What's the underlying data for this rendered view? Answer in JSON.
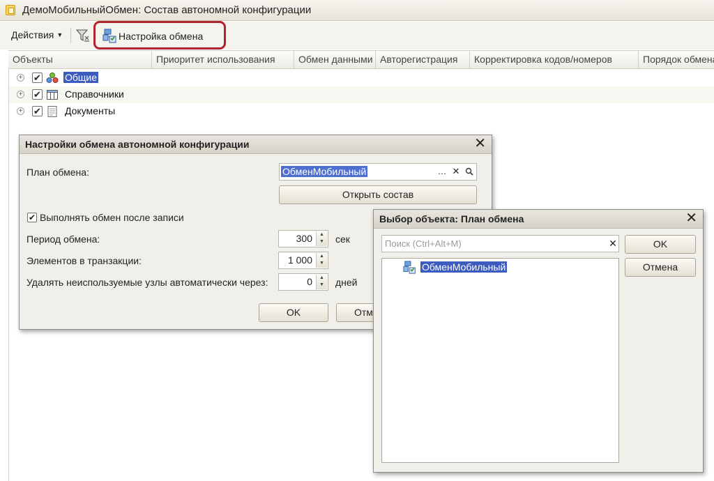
{
  "main": {
    "title": "ДемоМобильныйОбмен: Состав автономной конфигурации",
    "toolbar": {
      "actions_label": "Действия",
      "settings_label": "Настройка обмена"
    },
    "columns": [
      "Объекты",
      "Приоритет использования",
      "Обмен данными",
      "Авторегистрация",
      "Корректировка кодов/номеров",
      "Порядок обмена"
    ],
    "rows": [
      {
        "label": "Общие",
        "checked": true,
        "selected": true,
        "icon": "common-objects-icon"
      },
      {
        "label": "Справочники",
        "checked": true,
        "selected": false,
        "icon": "catalog-icon"
      },
      {
        "label": "Документы",
        "checked": true,
        "selected": false,
        "icon": "document-icon"
      }
    ]
  },
  "settings_dialog": {
    "title": "Настройки обмена автономной конфигурации",
    "plan_label": "План обмена:",
    "plan_value": "ОбменМобильный",
    "open_button": "Открыть состав",
    "exchange_after_write_label": "Выполнять обмен после записи",
    "exchange_after_write_checked": true,
    "period_label": "Период обмена:",
    "period_value": "300",
    "period_unit": "сек",
    "elements_label": "Элементов в транзакции:",
    "elements_value": "1 000",
    "delete_label": "Удалять неиспользуемые узлы автоматически через:",
    "delete_value": "0",
    "delete_unit": "дней",
    "ok_button": "OK",
    "cancel_button": "Отм"
  },
  "select_dialog": {
    "title": "Выбор объекта: План обмена",
    "search_placeholder": "Поиск (Ctrl+Alt+M)",
    "ok_button": "OK",
    "cancel_button": "Отмена",
    "items": [
      {
        "label": "ОбменМобильный",
        "selected": true,
        "icon": "exchange-plan-icon"
      }
    ]
  },
  "colors": {
    "selection": "#3b5bbf",
    "highlight_border": "#b2232f",
    "dialog_bg": "#f0efea"
  }
}
